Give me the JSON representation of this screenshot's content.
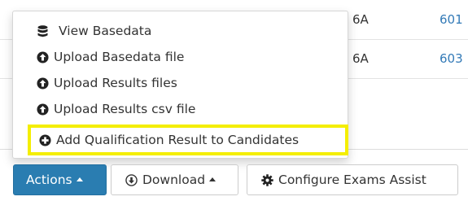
{
  "background_table": {
    "rows": [
      {
        "code": "6A",
        "number": "601"
      },
      {
        "code": "6A",
        "number": "603"
      }
    ]
  },
  "actions_menu": {
    "items": [
      {
        "label": "View Basedata",
        "icon": "database-icon"
      },
      {
        "label": "Upload Basedata file",
        "icon": "circle-arrow-up-icon"
      },
      {
        "label": "Upload Results files",
        "icon": "circle-arrow-up-icon"
      },
      {
        "label": "Upload Results csv file",
        "icon": "circle-arrow-up-icon"
      },
      {
        "label": "Add Qualification Result to Candidates",
        "icon": "circle-plus-icon",
        "highlighted": true
      }
    ]
  },
  "toolbar": {
    "actions_label": "Actions",
    "download_label": "Download",
    "configure_label": "Configure Exams Assist"
  },
  "colors": {
    "primary": "#2a7db1",
    "link": "#337ab7",
    "highlight_border": "#f4ee00"
  }
}
